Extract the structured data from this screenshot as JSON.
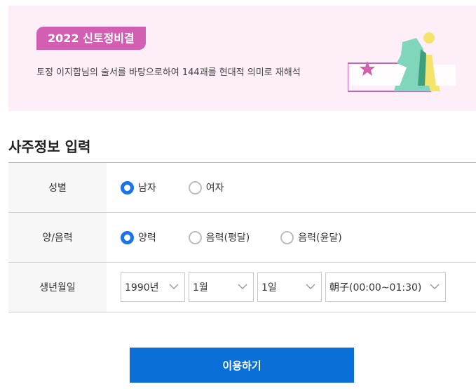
{
  "banner": {
    "badge": "2022 신토정비결",
    "description": "토정 이지함님의 술서를 바탕으로하여 144괘를 현대적 의미로 재해석"
  },
  "section": {
    "title": "사주정보 입력"
  },
  "form": {
    "gender": {
      "label": "성별",
      "options": [
        {
          "label": "남자",
          "checked": true
        },
        {
          "label": "여자",
          "checked": false
        }
      ]
    },
    "calendar": {
      "label": "양/음력",
      "options": [
        {
          "label": "양력",
          "checked": true
        },
        {
          "label": "음력(평달)",
          "checked": false
        },
        {
          "label": "음력(윤달)",
          "checked": false
        }
      ]
    },
    "birth": {
      "label": "생년월일",
      "year": "1990년",
      "month": "1월",
      "day": "1일",
      "hour": "朝子(00:00~01:30)"
    }
  },
  "submit_label": "이용하기",
  "colors": {
    "accent": "#0b6fd8",
    "badge": "#d35fb2",
    "banner_bg": "#fdeef8"
  },
  "icons": [
    "star-icon",
    "chess-knight-icon",
    "chess-pawn-icon",
    "chevron-down-icon"
  ]
}
